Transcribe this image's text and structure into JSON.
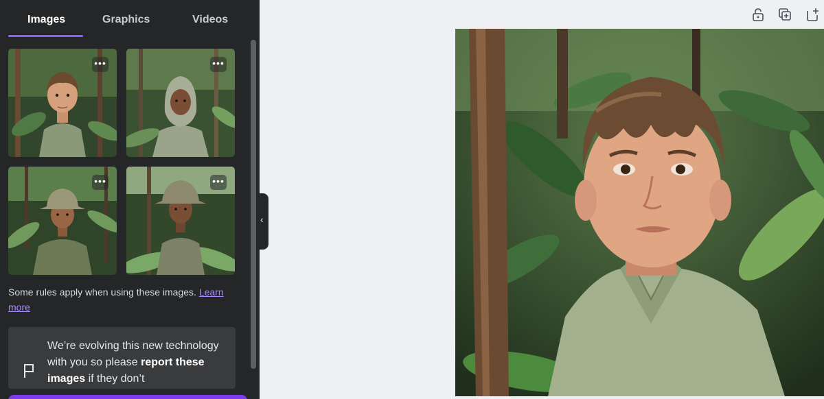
{
  "panel": {
    "tabs": [
      {
        "label": "Images",
        "active": true
      },
      {
        "label": "Graphics",
        "active": false
      },
      {
        "label": "Videos",
        "active": false
      }
    ],
    "more_glyph": "•••",
    "rules_text": "Some rules apply when using these images.",
    "rules_link": "Learn more",
    "notice": {
      "text_before": "We’re evolving this new technology with you so please",
      "text_bold": "report these images",
      "text_after": "if they don’t"
    }
  },
  "icons": {
    "flag": "flag-icon",
    "collapse": "chevron-left-icon",
    "lock": "lock-icon",
    "duplicate": "duplicate-page-icon",
    "add_page": "add-page-icon"
  },
  "colors": {
    "panel_bg": "#252627",
    "accent": "#8b5cf6",
    "canvas_bg": "#eef0f4"
  }
}
